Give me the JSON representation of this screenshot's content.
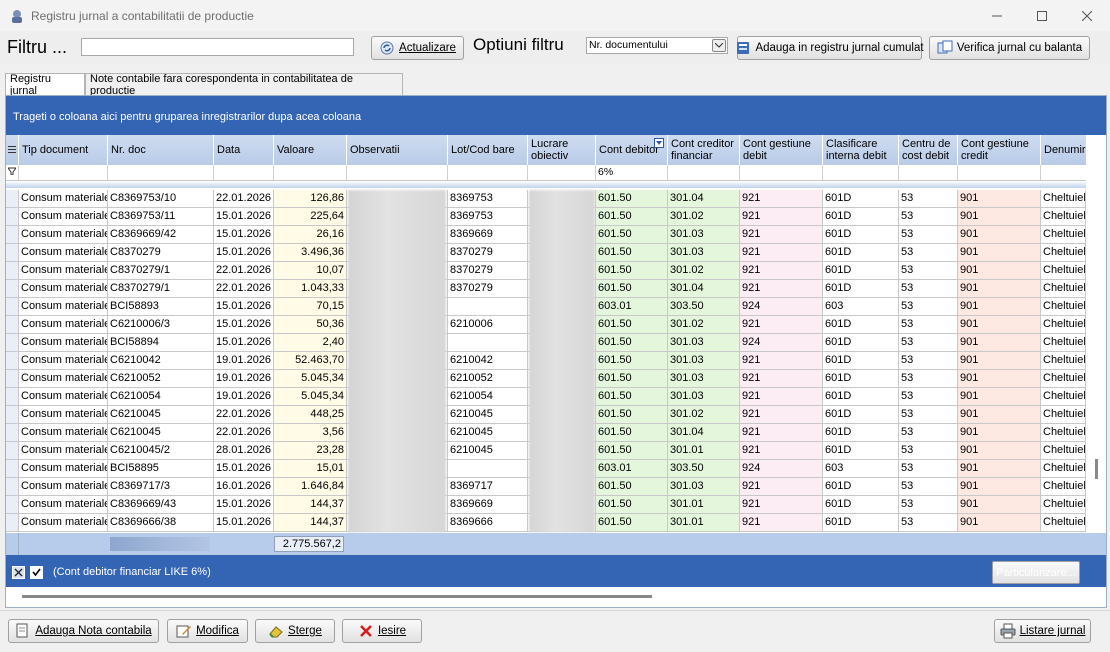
{
  "window": {
    "title": "Registru jurnal a contabilitatii de productie"
  },
  "toolbar": {
    "filtru_label": "Filtru ...",
    "filtru_value": "",
    "actualizare": "Actualizare",
    "optiuni_label": "Optiuni filtru",
    "optiuni_selected": "Nr. documentului",
    "adauga_cumulat": "Adauga in registru jurnal cumulat",
    "verifica": "Verifica jurnal cu balanta"
  },
  "tabs": [
    {
      "label": "Registru jurnal",
      "active": true
    },
    {
      "label": "Note contabile fara corespondenta in contabilitatea de productie",
      "active": false
    }
  ],
  "grid": {
    "group_hint": "Trageti o coloana aici pentru gruparea inregistrarilor dupa acea coloana",
    "columns": [
      "Tip document",
      "Nr. doc",
      "Data",
      "Valoare",
      "Observatii",
      "Lot/Cod bare",
      "Lucrare obiectiv",
      "Cont debitor",
      "Cont creditor financiar",
      "Cont gestiune debit",
      "Clasificare interna debit",
      "Centru de cost debit",
      "Cont gestiune credit",
      "Denumire"
    ],
    "filter_cont_debitor": "6%",
    "rows": [
      [
        "Consum materiale",
        "C8369753/10",
        "22.01.2026",
        "126,86",
        "8369753",
        "601.50",
        "301.04",
        "921",
        "601D",
        "53",
        "901",
        "Cheltuieli"
      ],
      [
        "Consum materiale",
        "C8369753/11",
        "15.01.2026",
        "225,64",
        "8369753",
        "601.50",
        "301.02",
        "921",
        "601D",
        "53",
        "901",
        "Cheltuieli"
      ],
      [
        "Consum materiale",
        "C8369669/42",
        "15.01.2026",
        "26,16",
        "8369669",
        "601.50",
        "301.03",
        "921",
        "601D",
        "53",
        "901",
        "Cheltuieli"
      ],
      [
        "Consum materiale",
        "C8370279",
        "15.01.2026",
        "3.496,36",
        "8370279",
        "601.50",
        "301.03",
        "921",
        "601D",
        "53",
        "901",
        "Cheltuieli"
      ],
      [
        "Consum materiale",
        "C8370279/1",
        "22.01.2026",
        "10,07",
        "8370279",
        "601.50",
        "301.02",
        "921",
        "601D",
        "53",
        "901",
        "Cheltuieli"
      ],
      [
        "Consum materiale",
        "C8370279/1",
        "22.01.2026",
        "1.043,33",
        "8370279",
        "601.50",
        "301.04",
        "921",
        "601D",
        "53",
        "901",
        "Cheltuieli"
      ],
      [
        "Consum materiale",
        "BCI58893",
        "15.01.2026",
        "70,15",
        "",
        "603.01",
        "303.50",
        "924",
        "603",
        "53",
        "901",
        "Cheltuieli"
      ],
      [
        "Consum materiale",
        "C6210006/3",
        "15.01.2026",
        "50,36",
        "6210006",
        "601.50",
        "301.02",
        "921",
        "601D",
        "53",
        "901",
        "Cheltuieli"
      ],
      [
        "Consum materiale",
        "BCI58894",
        "15.01.2026",
        "2,40",
        "",
        "601.50",
        "301.03",
        "924",
        "601D",
        "53",
        "901",
        "Cheltuieli"
      ],
      [
        "Consum materiale",
        "C6210042",
        "19.01.2026",
        "52.463,70",
        "6210042",
        "601.50",
        "301.03",
        "921",
        "601D",
        "53",
        "901",
        "Cheltuieli"
      ],
      [
        "Consum materiale",
        "C6210052",
        "19.01.2026",
        "5.045,34",
        "6210052",
        "601.50",
        "301.03",
        "921",
        "601D",
        "53",
        "901",
        "Cheltuieli"
      ],
      [
        "Consum materiale",
        "C6210054",
        "19.01.2026",
        "5.045,34",
        "6210054",
        "601.50",
        "301.03",
        "921",
        "601D",
        "53",
        "901",
        "Cheltuieli"
      ],
      [
        "Consum materiale",
        "C6210045",
        "22.01.2026",
        "448,25",
        "6210045",
        "601.50",
        "301.02",
        "921",
        "601D",
        "53",
        "901",
        "Cheltuieli"
      ],
      [
        "Consum materiale",
        "C6210045",
        "22.01.2026",
        "3,56",
        "6210045",
        "601.50",
        "301.04",
        "921",
        "601D",
        "53",
        "901",
        "Cheltuieli"
      ],
      [
        "Consum materiale",
        "C6210045/2",
        "28.01.2026",
        "23,28",
        "6210045",
        "601.50",
        "301.01",
        "921",
        "601D",
        "53",
        "901",
        "Cheltuieli"
      ],
      [
        "Consum materiale",
        "BCI58895",
        "15.01.2026",
        "15,01",
        "",
        "603.01",
        "303.50",
        "924",
        "603",
        "53",
        "901",
        "Cheltuieli"
      ],
      [
        "Consum materiale",
        "C8369717/3",
        "16.01.2026",
        "1.646,84",
        "8369717",
        "601.50",
        "301.03",
        "921",
        "601D",
        "53",
        "901",
        "Cheltuieli"
      ],
      [
        "Consum materiale",
        "C8369669/43",
        "15.01.2026",
        "144,37",
        "8369669",
        "601.50",
        "301.01",
        "921",
        "601D",
        "53",
        "901",
        "Cheltuieli"
      ],
      [
        "Consum materiale",
        "C8369666/38",
        "15.01.2026",
        "144,37",
        "8369666",
        "601.50",
        "301.01",
        "921",
        "601D",
        "53",
        "901",
        "Cheltuieli"
      ]
    ],
    "total_valoare": "2.775.567,2",
    "filter_expression": "(Cont debitor financiar LIKE 6%)",
    "particularizare": "Particularizare..."
  },
  "bottom": {
    "adauga": "Adauga Nota contabila",
    "modifica": "Modifica",
    "sterge": "Sterge",
    "iesire": "Iesire",
    "listare": "Listare jurnal"
  },
  "colors": {
    "group_bar": "#3465b5",
    "valoare_bg": "#fffbe6",
    "debit_bg": "#e4f7dc",
    "gest_debit_bg": "#fcecf3",
    "gest_credit_bg": "#fde8e2"
  }
}
